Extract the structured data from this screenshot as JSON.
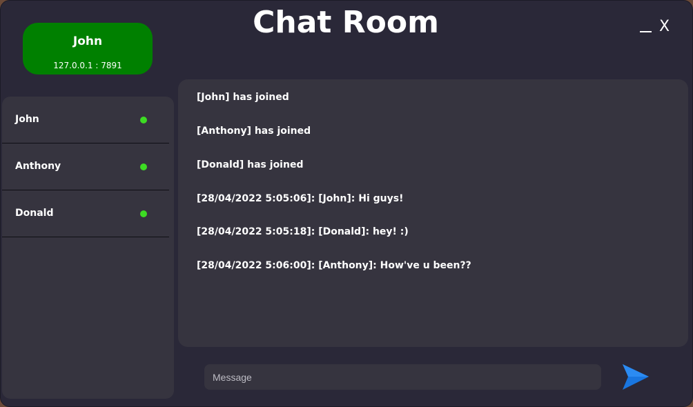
{
  "window": {
    "title": "Chat Room",
    "minimize_label": "_",
    "close_label": "X"
  },
  "user": {
    "name": "John",
    "address": "127.0.0.1 : 7891",
    "card_color": "#008000"
  },
  "members": [
    {
      "name": "John",
      "status": "online"
    },
    {
      "name": "Anthony",
      "status": "online"
    },
    {
      "name": "Donald",
      "status": "online"
    }
  ],
  "messages": [
    "[John] has joined",
    "[Anthony] has joined",
    "[Donald] has joined",
    "[28/04/2022 5:05:06]: [John]: Hi guys!",
    "[28/04/2022 5:05:18]: [Donald]: hey! :)",
    "[28/04/2022 5:06:00]: [Anthony]: How've u been??"
  ],
  "composer": {
    "placeholder": "Message",
    "send_icon": "send-icon"
  },
  "colors": {
    "background": "#2a2838",
    "panel": "#36343f",
    "online_dot": "#3ddc23",
    "send_icon": "#1976e0"
  }
}
